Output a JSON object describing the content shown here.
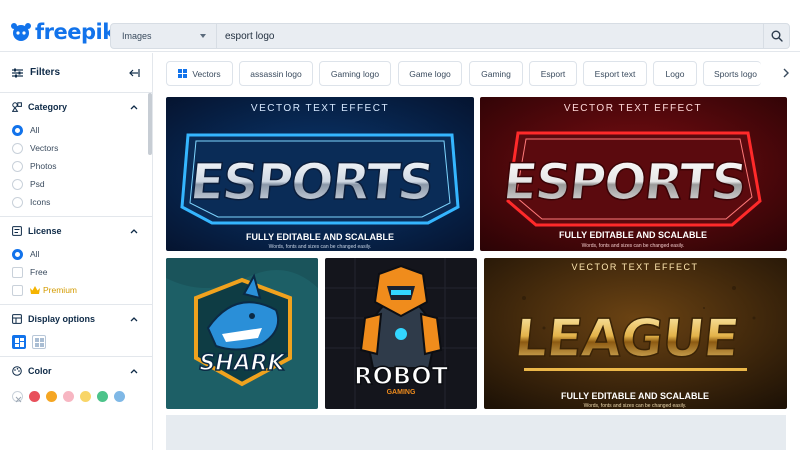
{
  "header": {
    "logo_text": "freepik",
    "search": {
      "type_label": "Images",
      "query": "esport logo"
    }
  },
  "sidebar": {
    "filters_label": "Filters",
    "category": {
      "title": "Category",
      "options": [
        "All",
        "Vectors",
        "Photos",
        "Psd",
        "Icons"
      ],
      "selected": "All"
    },
    "license": {
      "title": "License",
      "options": [
        "All",
        "Free",
        "Premium"
      ],
      "selected": "All"
    },
    "display": {
      "title": "Display options"
    },
    "color": {
      "title": "Color",
      "swatches": [
        "#e8505b",
        "#f5a623",
        "#f7b6c2",
        "#f8d568",
        "#4cc38a",
        "#7fb8e6"
      ]
    }
  },
  "tags": [
    "Vectors",
    "assassin logo",
    "Gaming logo",
    "Game logo",
    "Gaming",
    "Esport",
    "Esport text",
    "Logo",
    "Sports logo"
  ],
  "results": [
    {
      "id": "esports-blue",
      "top": "VECTOR TEXT EFFECT",
      "word": "ESPORTS",
      "sub1": "FULLY EDITABLE AND SCALABLE",
      "sub2": "Words, fonts and sizes can be changed easily."
    },
    {
      "id": "esports-red",
      "top": "VECTOR TEXT EFFECT",
      "word": "ESPORTS",
      "sub1": "FULLY EDITABLE AND SCALABLE",
      "sub2": "Words, fonts and sizes can be changed easily."
    },
    {
      "id": "shark",
      "word": "SHARK"
    },
    {
      "id": "robot",
      "word": "ROBOT",
      "sub": "GAMING"
    },
    {
      "id": "league",
      "top": "VECTOR TEXT EFFECT",
      "word": "LEAGUE",
      "sub1": "FULLY EDITABLE AND SCALABLE",
      "sub2": "Words, fonts and sizes can be changed easily."
    }
  ],
  "colors": {
    "brand": "#1273eb",
    "premium": "#d49b00"
  }
}
